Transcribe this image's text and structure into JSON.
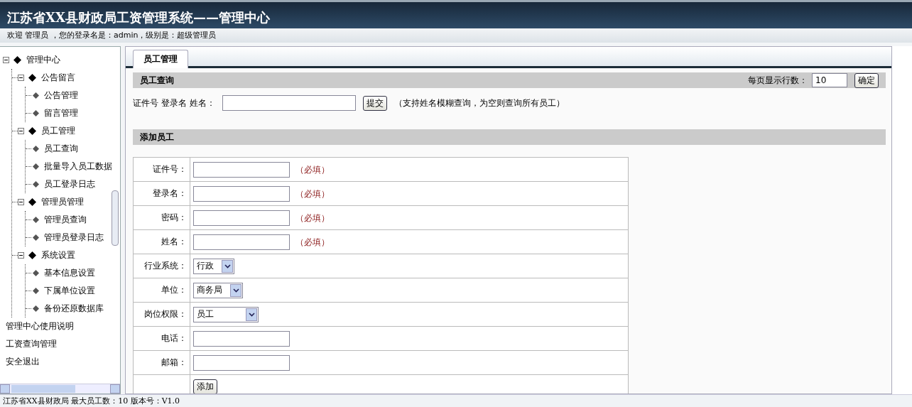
{
  "header": {
    "title": "江苏省XX县财政局工资管理系统——管理中心",
    "welcome": "欢迎 管理员 ，您的登录名是：admin，级别是：超级管理员"
  },
  "sidebar": {
    "tree": [
      {
        "label": "管理中心",
        "expanded": true,
        "children": [
          {
            "label": "公告留言",
            "expanded": true,
            "children": [
              {
                "label": "公告管理"
              },
              {
                "label": "留言管理"
              }
            ]
          },
          {
            "label": "员工管理",
            "expanded": true,
            "children": [
              {
                "label": "员工查询"
              },
              {
                "label": "批量导入员工数据"
              },
              {
                "label": "员工登录日志"
              }
            ]
          },
          {
            "label": "管理员管理",
            "expanded": true,
            "children": [
              {
                "label": "管理员查询"
              },
              {
                "label": "管理员登录日志"
              }
            ]
          },
          {
            "label": "系统设置",
            "expanded": true,
            "children": [
              {
                "label": "基本信息设置"
              },
              {
                "label": "下属单位设置"
              },
              {
                "label": "备份还原数据库"
              }
            ]
          }
        ]
      }
    ],
    "links": [
      "管理中心使用说明",
      "工资查询管理",
      "安全退出"
    ]
  },
  "tabs": [
    {
      "label": "员工管理",
      "selected": true
    }
  ],
  "query": {
    "title": "员工查询",
    "page_size_label": "每页显示行数：",
    "page_size": "10",
    "confirm": "确定",
    "search_label": "证件号 登录名 姓名：",
    "submit": "提交",
    "hint": "（支持姓名模糊查询，为空则查询所有员工）"
  },
  "add": {
    "title": "添加员工",
    "rows": [
      {
        "kind": "text",
        "label": "证件号：",
        "note": "（必填）"
      },
      {
        "kind": "text",
        "label": "登录名：",
        "note": "（必填）"
      },
      {
        "kind": "text",
        "label": "密码：",
        "note": "（必填）"
      },
      {
        "kind": "text",
        "label": "姓名：",
        "note": "（必填）"
      },
      {
        "kind": "select",
        "label": "行业系统：",
        "value": "行政"
      },
      {
        "kind": "select",
        "label": "单位：",
        "value": "商务局"
      },
      {
        "kind": "select",
        "label": "岗位权限：",
        "value": "员工",
        "wide": true
      },
      {
        "kind": "text",
        "label": "电话："
      },
      {
        "kind": "text",
        "label": "邮箱："
      },
      {
        "kind": "button",
        "value": "添加"
      }
    ]
  },
  "status_bar": "江苏省XX县财政局  最大员工数：10  版本号：V1.0"
}
